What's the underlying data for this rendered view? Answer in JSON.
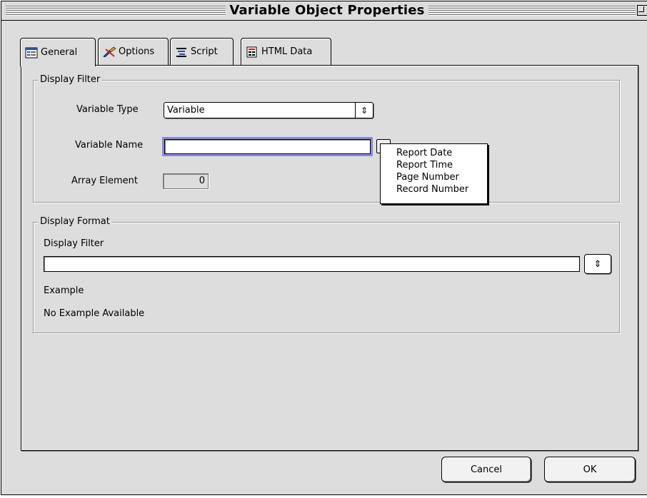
{
  "window": {
    "title": "Variable Object Properties"
  },
  "tabs": [
    {
      "label": "General",
      "icon": "general-icon",
      "active": true
    },
    {
      "label": "Options",
      "icon": "options-icon",
      "active": false
    },
    {
      "label": "Script",
      "icon": "script-icon",
      "active": false
    },
    {
      "label": "HTML Data",
      "icon": "html-data-icon",
      "active": false
    }
  ],
  "display_filter_group": {
    "title": "Display Filter",
    "variable_type_label": "Variable Type",
    "variable_type_value": "Variable",
    "variable_name_label": "Variable Name",
    "variable_name_value": "",
    "array_element_label": "Array Element",
    "array_element_value": "0"
  },
  "variable_menu": {
    "items": [
      "Report Date",
      "Report Time",
      "Page Number",
      "Record Number"
    ]
  },
  "display_format_group": {
    "title": "Display Format",
    "display_filter_label": "Display Filter",
    "display_filter_value": "",
    "example_label": "Example",
    "example_value": "No Example Available"
  },
  "buttons": {
    "cancel": "Cancel",
    "ok": "OK"
  }
}
